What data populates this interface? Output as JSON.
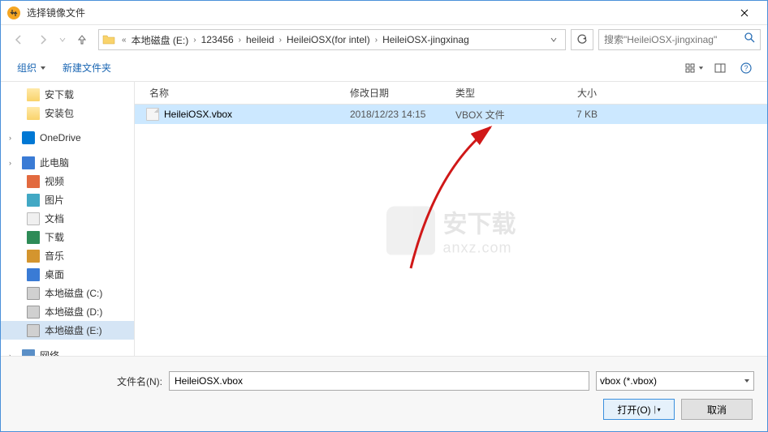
{
  "title": "选择镜像文件",
  "breadcrumb": {
    "prefix": "«",
    "items": [
      "本地磁盘 (E:)",
      "123456",
      "heileid",
      "HeileiOSX(for intel)",
      "HeileiOSX-jingxinag"
    ]
  },
  "search": {
    "placeholder": "搜索\"HeileiOSX-jingxinag\""
  },
  "toolbar": {
    "organize": "组织",
    "new_folder": "新建文件夹"
  },
  "sidebar": {
    "items": [
      {
        "label": "安下载",
        "icon": "ico-folder",
        "type": "child"
      },
      {
        "label": "安装包",
        "icon": "ico-folder",
        "type": "child"
      },
      {
        "label": "OneDrive",
        "icon": "ico-onedrive",
        "type": "root",
        "caret": true
      },
      {
        "label": "此电脑",
        "icon": "ico-pc",
        "type": "root",
        "caret": true
      },
      {
        "label": "视频",
        "icon": "ico-video",
        "type": "child"
      },
      {
        "label": "图片",
        "icon": "ico-picture",
        "type": "child"
      },
      {
        "label": "文档",
        "icon": "ico-doc",
        "type": "child"
      },
      {
        "label": "下载",
        "icon": "ico-download",
        "type": "child"
      },
      {
        "label": "音乐",
        "icon": "ico-music",
        "type": "child"
      },
      {
        "label": "桌面",
        "icon": "ico-desktop",
        "type": "child"
      },
      {
        "label": "本地磁盘 (C:)",
        "icon": "ico-drive",
        "type": "child"
      },
      {
        "label": "本地磁盘 (D:)",
        "icon": "ico-drive",
        "type": "child"
      },
      {
        "label": "本地磁盘 (E:)",
        "icon": "ico-drive",
        "type": "child",
        "selected": true
      },
      {
        "label": "网络",
        "icon": "ico-net",
        "type": "root",
        "caret": true
      }
    ]
  },
  "columns": {
    "name": "名称",
    "date": "修改日期",
    "type": "类型",
    "size": "大小"
  },
  "files": [
    {
      "name": "HeileiOSX.vbox",
      "date": "2018/12/23 14:15",
      "type": "VBOX 文件",
      "size": "7 KB",
      "selected": true
    }
  ],
  "watermark": {
    "main": "安下载",
    "sub": "anxz.com"
  },
  "footer": {
    "filename_label": "文件名(N):",
    "filename_value": "HeileiOSX.vbox",
    "filter": "vbox (*.vbox)",
    "open": "打开(O)",
    "cancel": "取消"
  }
}
